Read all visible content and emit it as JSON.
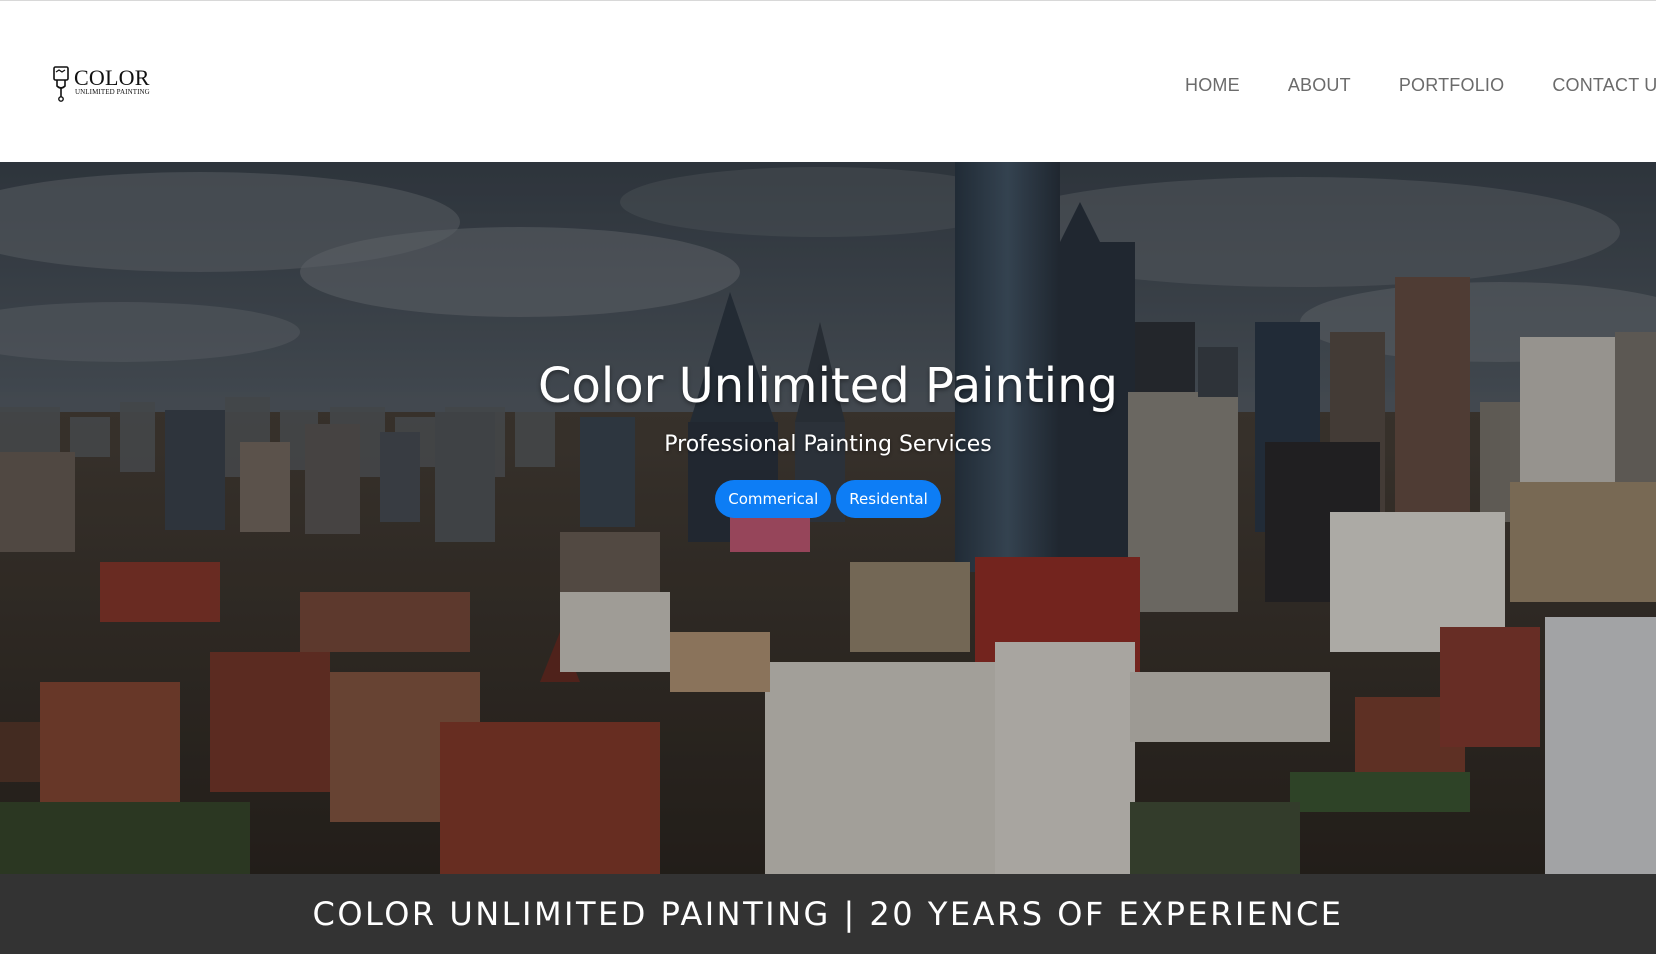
{
  "logo": {
    "word": "COLOR",
    "subtitle": "UNLIMITED PAINTING",
    "icon": "paintbrush-icon"
  },
  "nav": {
    "items": [
      {
        "label": "HOME"
      },
      {
        "label": "ABOUT"
      },
      {
        "label": "PORTFOLIO"
      },
      {
        "label": "CONTACT US"
      }
    ]
  },
  "hero": {
    "title": "Color Unlimited Painting",
    "subtitle": "Professional Painting Services",
    "buttons": [
      {
        "label": "Commerical"
      },
      {
        "label": "Residental"
      }
    ],
    "background": "city-skyline-photo"
  },
  "banner": {
    "text": "COLOR UNLIMITED PAINTING | 20 YEARS OF EXPERIENCE"
  },
  "colors": {
    "accent": "#0d7df5",
    "nav_text": "#6b6b6b",
    "banner_bg": "#333333"
  }
}
